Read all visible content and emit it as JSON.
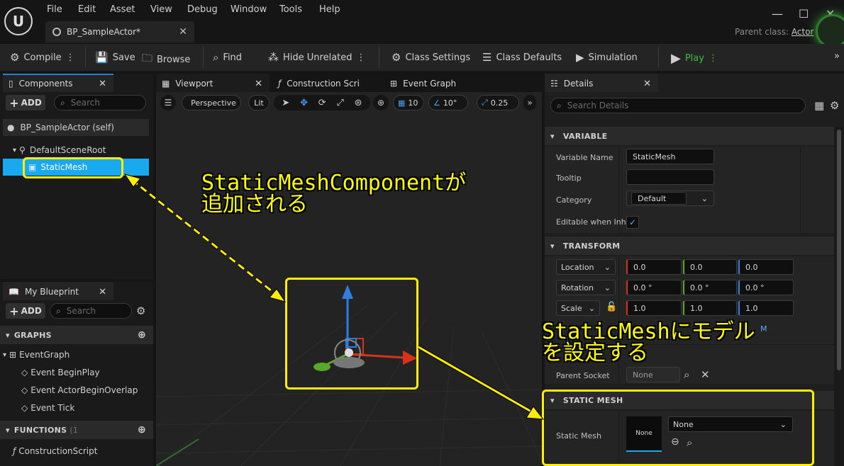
{
  "menu": [
    "File",
    "Edit",
    "Asset",
    "View",
    "Debug",
    "Window",
    "Tools",
    "Help"
  ],
  "doc_tab": "BP_SampleActor*",
  "parent_class_label": "Parent class:",
  "parent_class_value": "Actor",
  "toolbar": {
    "compile": "Compile",
    "save": "Save",
    "browse": "Browse",
    "find": "Find",
    "hide_unrelated": "Hide Unrelated",
    "class_settings": "Class Settings",
    "class_defaults": "Class Defaults",
    "simulation": "Simulation",
    "play": "Play"
  },
  "components": {
    "tab": "Components",
    "add": "ADD",
    "search_placeholder": "Search",
    "self_item": "BP_SampleActor (self)",
    "root": "DefaultSceneRoot",
    "selected": "StaticMesh"
  },
  "my_blueprint": {
    "tab": "My Blueprint",
    "add": "ADD",
    "search_placeholder": "Search",
    "graphs_header": "GRAPHS",
    "event_graph": "EventGraph",
    "events": [
      "Event BeginPlay",
      "Event ActorBeginOverlap",
      "Event Tick"
    ],
    "functions_header": "FUNCTIONS",
    "functions_count": "(1",
    "construction_script": "ConstructionScript"
  },
  "center_tabs": [
    "Viewport",
    "Construction Scri",
    "Event Graph"
  ],
  "viewport_toolbar": {
    "perspective": "Perspective",
    "lit": "Lit",
    "grid_snap": "10",
    "rot_snap": "10°",
    "scale_snap": "0.25"
  },
  "details": {
    "tab": "Details",
    "search_placeholder": "Search Details",
    "variable_header": "VARIABLE",
    "variable_name_label": "Variable Name",
    "variable_name_value": "StaticMesh",
    "tooltip_label": "Tooltip",
    "category_label": "Category",
    "category_value": "Default",
    "editable_label": "Editable when Inh",
    "transform_header": "TRANSFORM",
    "location_label": "Location",
    "location": [
      "0.0",
      "0.0",
      "0.0"
    ],
    "rotation_label": "Rotation",
    "rotation": [
      "0.0 °",
      "0.0 °",
      "0.0 °"
    ],
    "scale_label": "Scale",
    "scale": [
      "1.0",
      "1.0",
      "1.0"
    ],
    "parent_socket_label": "Parent Socket",
    "parent_socket_value": "None",
    "static_mesh_header": "STATIC MESH",
    "static_mesh_label": "Static Mesh",
    "thumb_label": "None",
    "static_mesh_value": "None",
    "partial_text": "M"
  },
  "annotations": {
    "top_line1": "StaticMeshComponentが",
    "top_line2": "追加される",
    "right_line1": "StaticMeshにモデル",
    "right_line2": "を設定する"
  },
  "colors": {
    "selection": "#19a9ef",
    "annotation": "#ffff00",
    "accent_blue": "#2a7fd4",
    "play_green": "#3fbf3f"
  }
}
